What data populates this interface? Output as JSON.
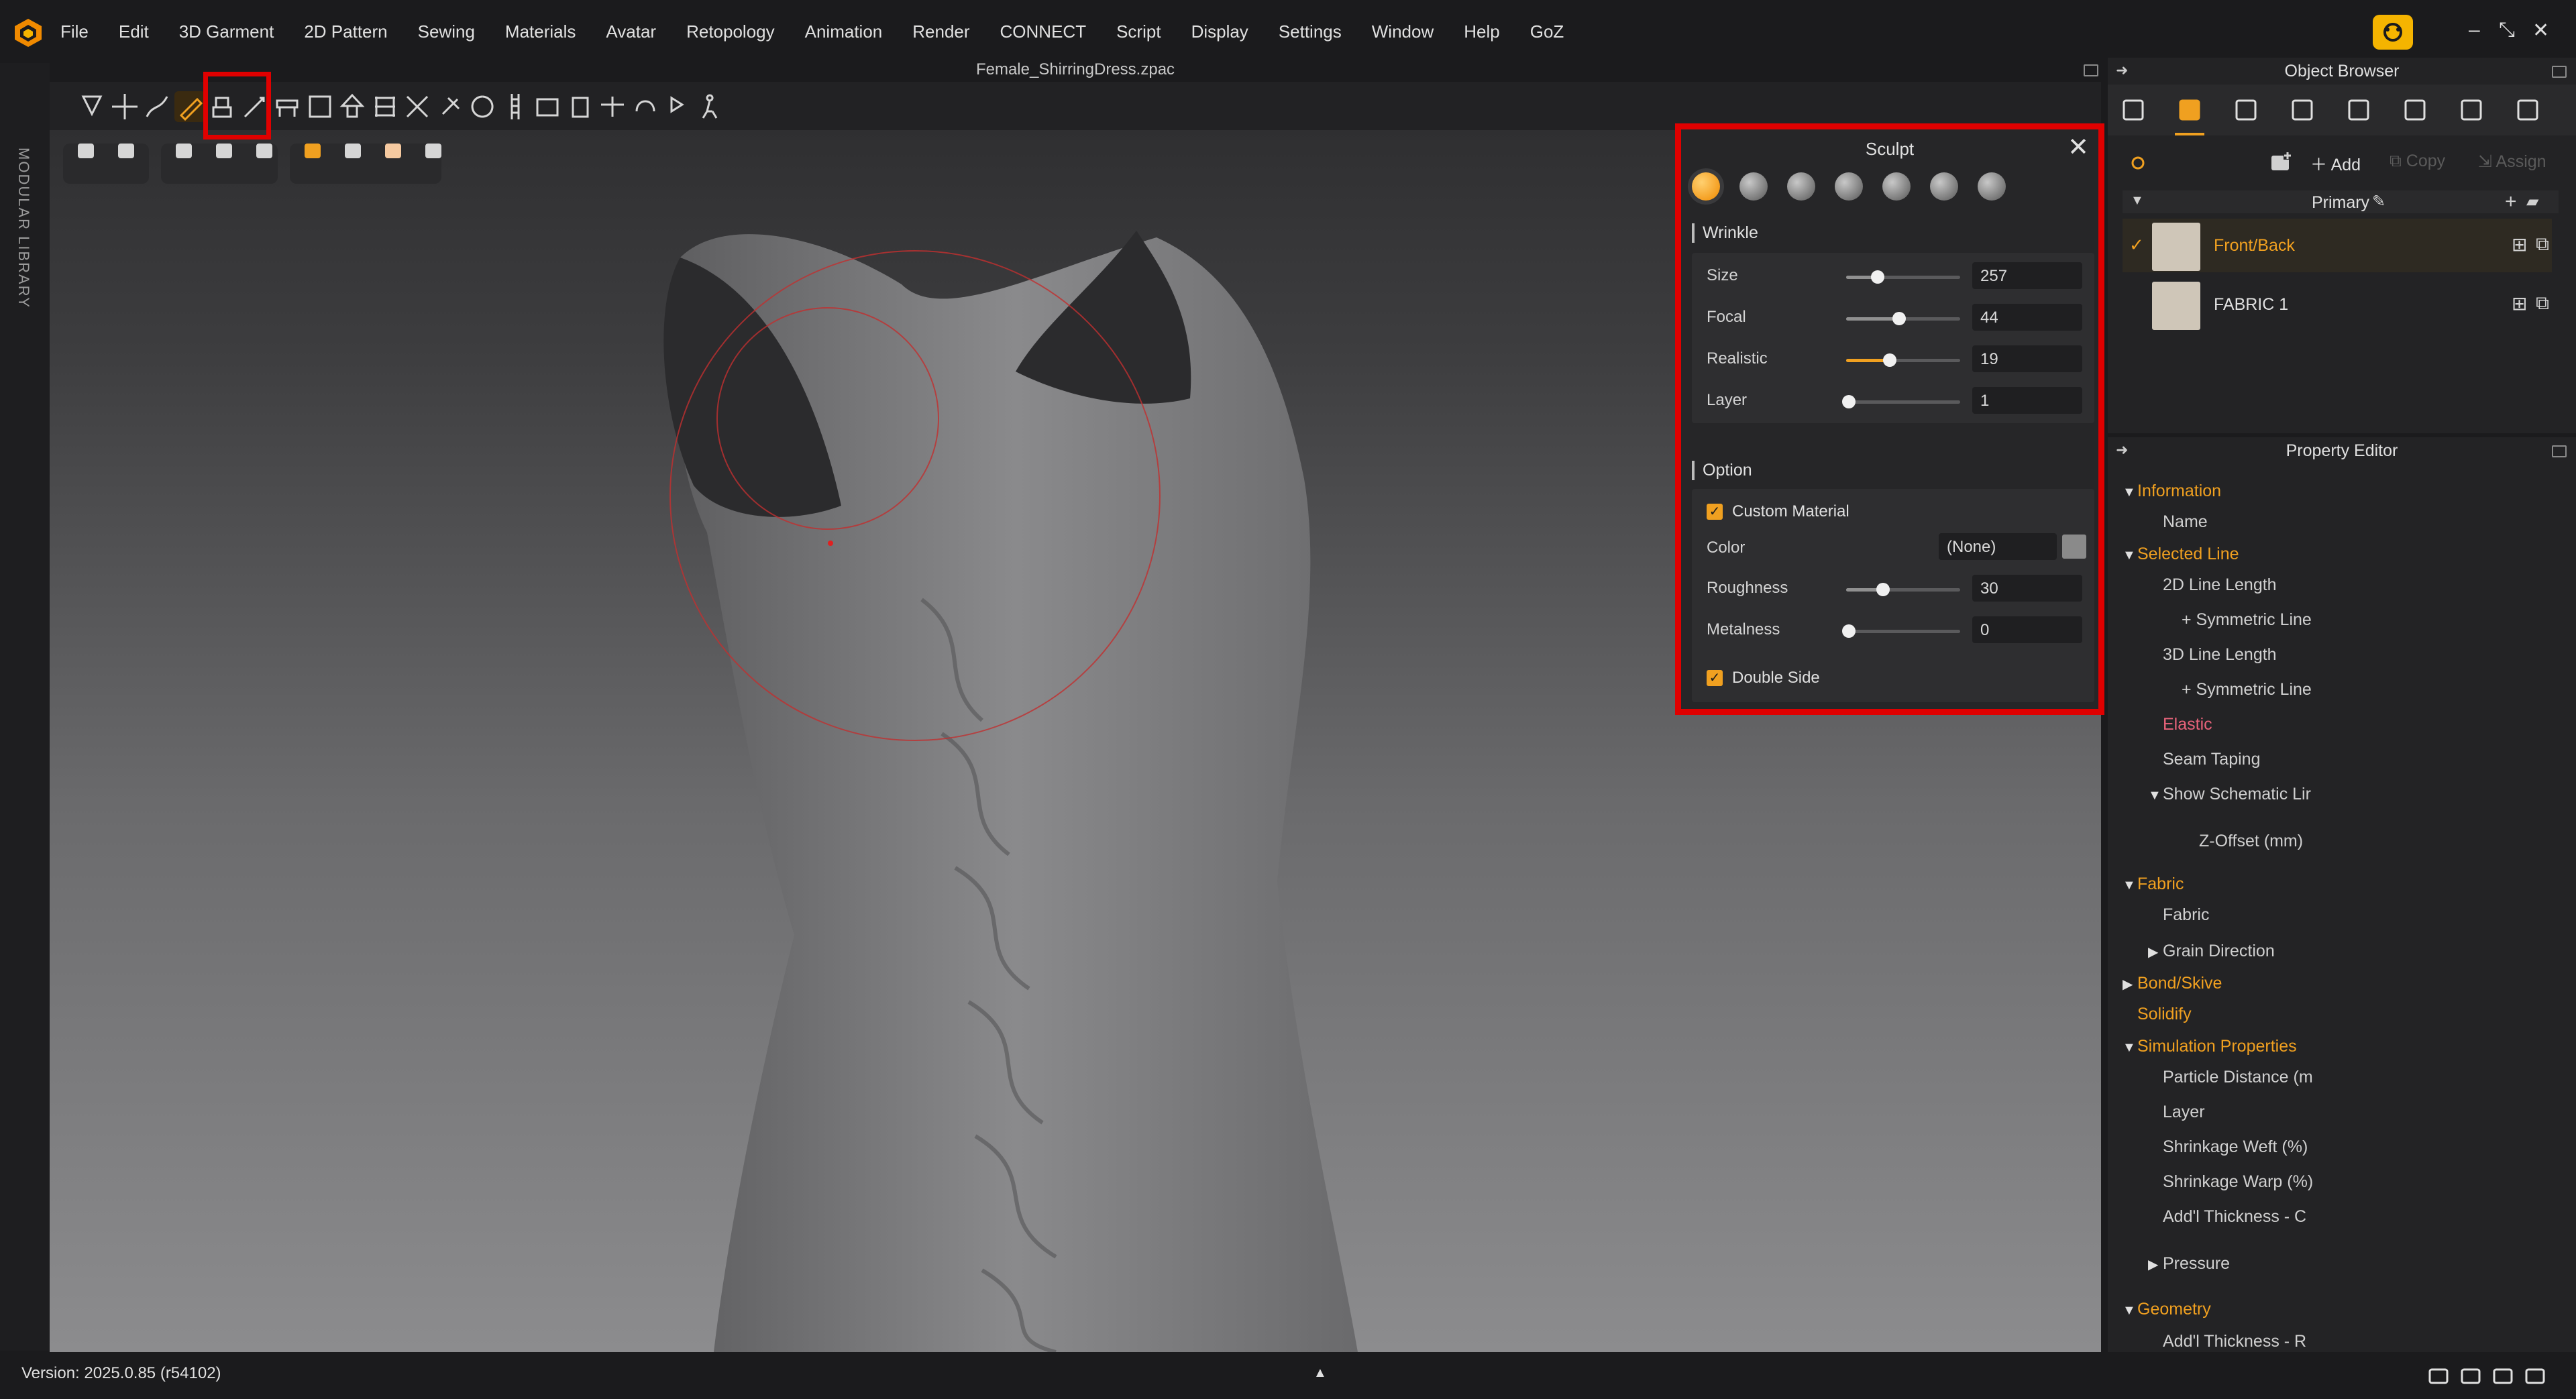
{
  "app": {
    "file_title": "Female_ShirringDress.zpac",
    "version": "Version: 2025.0.85 (r54102)",
    "left_strip_label": "MODULAR LIBRARY"
  },
  "menu": [
    "File",
    "Edit",
    "3D Garment",
    "2D Pattern",
    "Sewing",
    "Materials",
    "Avatar",
    "Retopology",
    "Animation",
    "Render",
    "CONNECT",
    "Script",
    "Display",
    "Settings",
    "Window",
    "Help",
    "GoZ"
  ],
  "window_controls": {
    "minimize": "–",
    "restore": "⤡",
    "close": "✕"
  },
  "toolbar": {
    "icons": [
      "drop-icon",
      "move-icon",
      "sculpt-stroke-icon",
      "sculpt-brush-icon",
      "avatar-drape-icon",
      "edit-line-icon",
      "fold-icon",
      "transform-icon",
      "arrangement-icon",
      "gizmo-icon",
      "wrap-icon",
      "pin-icon",
      "arrangement-point-icon",
      "zipper-icon",
      "tack-icon",
      "solidify-icon",
      "trim-icon",
      "measure-icon",
      "pose-icon",
      "avatar-walk-icon"
    ],
    "active_index": 3
  },
  "subtoolbar": {
    "groups": [
      [
        "cube-icon",
        "garment-fold-icon"
      ],
      [
        "shirt-icon",
        "avatar-shirt-icon",
        "avatar-icon"
      ],
      [
        "texture-icon",
        "fabric-icon",
        "skin-icon",
        "globe-icon"
      ]
    ]
  },
  "sculpt": {
    "title": "Sculpt",
    "close": "✕",
    "brushes": [
      "wrinkle-brush",
      "smooth-brush",
      "inflate-brush",
      "flatten-brush",
      "pinch-brush",
      "relax-brush",
      "randomize-brush"
    ],
    "wrinkle_title": "Wrinkle",
    "wrinkle": [
      {
        "label": "Size",
        "value": "257",
        "fraction": 0.25
      },
      {
        "label": "Focal",
        "value": "44",
        "fraction": 0.44
      },
      {
        "label": "Realistic",
        "value": "19",
        "fraction": 0.36
      },
      {
        "label": "Layer",
        "value": "1",
        "fraction": 0.0
      }
    ],
    "option_title": "Option",
    "custom_material_label": "Custom Material",
    "custom_material_checked": true,
    "color_label": "Color",
    "color_value": "(None)",
    "roughness": {
      "label": "Roughness",
      "value": "30",
      "fraction": 0.3
    },
    "metalness": {
      "label": "Metalness",
      "value": "0",
      "fraction": 0.0
    },
    "double_side_label": "Double Side",
    "double_side_checked": true
  },
  "object_browser": {
    "title": "Object Browser",
    "tabs": [
      "list-icon",
      "fabric-tab-icon",
      "checker-icon",
      "button-icon",
      "line-icon",
      "topstitch-icon",
      "zipper-tab-icon",
      "hanger-icon"
    ],
    "actions": {
      "add": "Add",
      "copy": "Copy",
      "assign": "Assign"
    },
    "group": "Primary",
    "items": [
      {
        "name": "Front/Back",
        "selected": true
      },
      {
        "name": "FABRIC 1",
        "selected": false
      }
    ]
  },
  "property_editor": {
    "title": "Property Editor",
    "tree": [
      {
        "label": "Information",
        "level": 0,
        "kind": "section",
        "open": true
      },
      {
        "label": "Name",
        "level": 1,
        "kind": "item"
      },
      {
        "label": "Selected Line",
        "level": 0,
        "kind": "section",
        "open": true
      },
      {
        "label": "2D Line Length",
        "level": 1,
        "kind": "item"
      },
      {
        "label": "+ Symmetric Line",
        "level": 2,
        "kind": "item"
      },
      {
        "label": "3D Line Length",
        "level": 1,
        "kind": "item"
      },
      {
        "label": "+ Symmetric Line",
        "level": 2,
        "kind": "item"
      },
      {
        "label": "Elastic",
        "level": 1,
        "kind": "pink"
      },
      {
        "label": "Seam Taping",
        "level": 1,
        "kind": "item"
      },
      {
        "label": "Show Schematic Lir",
        "level": 1,
        "kind": "group",
        "open": true
      },
      {
        "label": "Z-Offset (mm)",
        "level": 3,
        "kind": "item"
      },
      {
        "label": "Fabric",
        "level": 0,
        "kind": "section",
        "open": true
      },
      {
        "label": "Fabric",
        "level": 1,
        "kind": "item"
      },
      {
        "label": "Grain Direction",
        "level": 1,
        "kind": "group",
        "open": false
      },
      {
        "label": "Bond/Skive",
        "level": 0,
        "kind": "section",
        "open": false
      },
      {
        "label": "Solidify",
        "level": 0,
        "kind": "section-plain"
      },
      {
        "label": "Simulation Properties",
        "level": 0,
        "kind": "section",
        "open": true
      },
      {
        "label": "Particle Distance (m",
        "level": 1,
        "kind": "item"
      },
      {
        "label": "Layer",
        "level": 1,
        "kind": "item"
      },
      {
        "label": "Shrinkage Weft (%)",
        "level": 1,
        "kind": "item"
      },
      {
        "label": "Shrinkage Warp (%)",
        "level": 1,
        "kind": "item"
      },
      {
        "label": "Add'l Thickness - C",
        "level": 1,
        "kind": "item"
      },
      {
        "label": "Pressure",
        "level": 1,
        "kind": "group",
        "open": false
      },
      {
        "label": "Geometry",
        "level": 0,
        "kind": "section",
        "open": true
      },
      {
        "label": "Add'l Thickness - R",
        "level": 1,
        "kind": "item"
      }
    ]
  },
  "status_icons": [
    "2d-3d-view-icon",
    "3d-view-icon",
    "2d-view-icon",
    "refresh-icon"
  ],
  "status_center": "▲",
  "colors": {
    "accent": "#f0a020",
    "highlight": "#e00000",
    "pink": "#e8637a"
  }
}
